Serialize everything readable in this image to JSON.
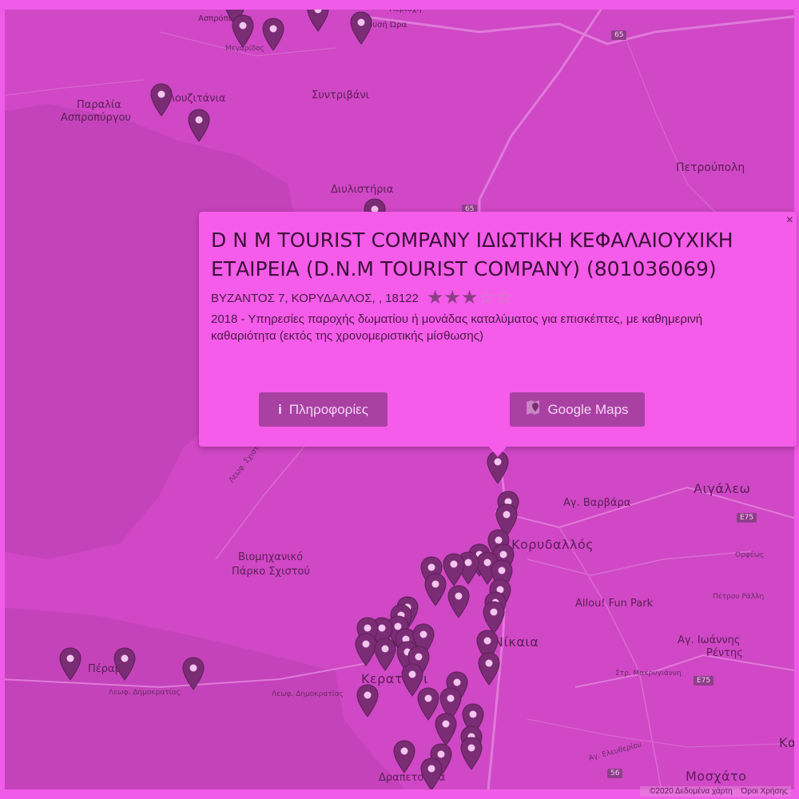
{
  "map": {
    "labels": {
      "aspropyrgos": "Ασπρόπυργος",
      "megaridos": "Μεγαρίδος",
      "periochi": "Περιοχή",
      "chrysi_ora": "Χρυσή Ώρα",
      "paralia": "Παραλία",
      "paralia2": "Ασπροπύργου",
      "lousitania": "Λουζιτάνια",
      "syntrivani": "Συντριβάνι",
      "petroupoli": "Πετρούπολη",
      "diylistiria": "Διυλιστήρια",
      "aigaleo": "Αιγάλεω",
      "ag_varvara": "Αγ. Βαρβάρα",
      "korydallos": "Κορυδαλλός",
      "viomichaniko": "Βιομηχανικό",
      "parko": "Πάρκο Σχιστού",
      "allou": "Allou! Fun Park",
      "petrou_ralli": "Πέτρου Ράλλη",
      "nikaia": "Νίκαια",
      "ag_ioannis": "Αγ. Ιωάννης",
      "rentis": "Ρέντης",
      "perama": "Πέραμα",
      "keratsini": "Κερατσίνι",
      "drapetsona": "Δραπετσώνα",
      "moschato": "Μοσχάτο",
      "kallithea": "Κα",
      "leof_dimokratias1": "Λεωφ. Δημοκρατίας",
      "leof_dimokratias2": "Λεωφ. Δημοκρατίας",
      "str_makrygianni": "Στρ. Μακρυγιάννη",
      "leof_schistou": "Λεωφ. Σχιστού Σκαραμαγκά",
      "orfeos": "Ορφέως",
      "ag_eleftheriou": "Αγ. Ελευθερίου"
    },
    "shields": {
      "e65_top": "65",
      "e65_mid": "65",
      "e75_a": "E75",
      "e75_b": "E75",
      "e56": "56"
    }
  },
  "popup": {
    "title": "D N M TOURIST COMPANY ΙΔΙΩΤΙΚΗ ΚΕΦΑΛΑΙΟΥΧΙΚΗ ΕΤΑΙΡΕΙΑ (D.N.M TOURIST COMPANY) (801036069)",
    "address": "ΒΥΖΑΝΤΟΣ 7, ΚΟΡΥΔΑΛΛΟΣ, , 18122",
    "rating": 3,
    "rating_max": 5,
    "description": "2018 - Υπηρεσίες παροχής δωματίου ή μονάδας καταλύματος για επισκέπτες, με καθημερινή καθαριότητα (εκτός της χρονομεριστικής μίσθωσης)",
    "info_button": "Πληροφορίες",
    "gmaps_button": "Google Maps",
    "close": "×"
  },
  "attribution": {
    "data": "©2020 Δεδομένα χάρτη",
    "terms": "Όροι Χρήσης"
  },
  "colors": {
    "overlay": "#d048c6",
    "popup_bg": "#f55ce9",
    "marker": "#7a2c74",
    "button_bg": "#a941a3"
  },
  "icons": {
    "marker": "map-pin-icon",
    "info": "info-icon",
    "google_maps": "google-maps-icon"
  }
}
